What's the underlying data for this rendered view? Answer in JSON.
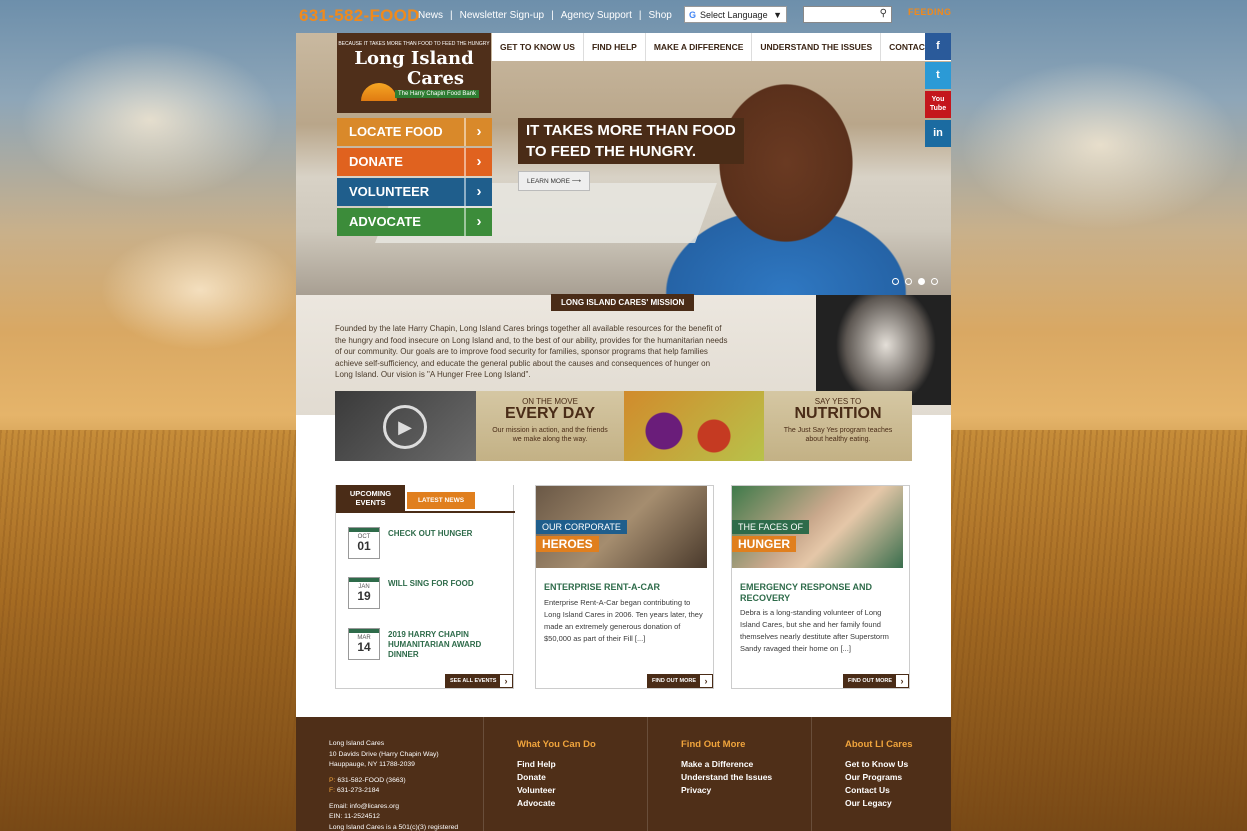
{
  "topbar": {
    "phone": "631-582-FOOD",
    "links": [
      "News",
      "Newsletter Sign-up",
      "Agency Support",
      "Shop"
    ],
    "language_label": "Select Language",
    "feeding_label": "FEEDING"
  },
  "logo": {
    "tagline": "BECAUSE IT TAKES MORE THAN FOOD TO FEED THE HUNGRY",
    "line1": "Long Island",
    "line2": "Cares",
    "subtitle": "The Harry Chapin Food Bank"
  },
  "nav": [
    "GET TO KNOW US",
    "FIND HELP",
    "MAKE A DIFFERENCE",
    "UNDERSTAND THE ISSUES",
    "CONTACT US"
  ],
  "social": [
    "f",
    "t",
    "You Tube",
    "in"
  ],
  "cta": [
    {
      "label": "LOCATE FOOD",
      "color": "#d9892a"
    },
    {
      "label": "DONATE",
      "color": "#e0621f"
    },
    {
      "label": "VOLUNTEER",
      "color": "#1f5e8c"
    },
    {
      "label": "ADVOCATE",
      "color": "#3c8c3a"
    }
  ],
  "hero": {
    "headline1": "IT TAKES MORE THAN FOOD",
    "headline2": "TO FEED THE HUNGRY.",
    "learn_more": "LEARN MORE",
    "slides": 4,
    "active_slide": 3
  },
  "mission": {
    "title": "LONG ISLAND CARES' MISSION",
    "text": "Founded by the late Harry Chapin, Long Island Cares brings together all available resources for the benefit of the hungry and food insecure on Long Island and, to the best of our ability, provides for the humanitarian needs of our community. Our goals are to improve food security for families, sponsor programs that help families achieve self-sufficiency, and educate the general public about the causes and consequences of hunger on Long Island. Our vision is \"A Hunger Free Long Island\"."
  },
  "promo": {
    "everyday": {
      "kicker": "ON THE MOVE",
      "title": "EVERY DAY",
      "desc": "Our mission in action, and the friends we make along the way."
    },
    "nutrition": {
      "kicker": "SAY YES TO",
      "title": "NUTRITION",
      "desc": "The Just Say Yes program teaches about healthy eating."
    }
  },
  "events": {
    "tab_upcoming": "UPCOMING EVENTS",
    "tab_latest": "LATEST NEWS",
    "items": [
      {
        "month": "OCT",
        "day": "01",
        "title": "CHECK OUT HUNGER"
      },
      {
        "month": "JAN",
        "day": "19",
        "title": "WILL SING FOR FOOD"
      },
      {
        "month": "MAR",
        "day": "14",
        "title": "2019 HARRY CHAPIN HUMANITARIAN AWARD DINNER"
      }
    ],
    "see_all": "SEE ALL EVENTS"
  },
  "cards": [
    {
      "label1": "OUR CORPORATE",
      "label2": "HEROES",
      "heading": "ENTERPRISE RENT-A-CAR",
      "body": "Enterprise Rent-A-Car began contributing to Long Island Cares in 2006. Ten years later, they made an extremely generous donation of $50,000 as part of their Fill [...]",
      "more": "FIND OUT MORE"
    },
    {
      "label1": "THE FACES OF",
      "label2": "HUNGER",
      "heading": "EMERGENCY RESPONSE AND RECOVERY",
      "body": "Debra is a long-standing volunteer of Long Island Cares, but she and her family found themselves nearly destitute after Superstorm Sandy ravaged their home on [...]",
      "more": "FIND OUT MORE"
    }
  ],
  "footer": {
    "org": "Long Island Cares",
    "street": "10 Davids Drive (Harry Chapin Way)",
    "city": "Hauppauge, NY 11788-2039",
    "phone_prefix": "P:",
    "phone": "631-582-FOOD (3663)",
    "fax_prefix": "F:",
    "fax": "631-273-2184",
    "email": "Email: info@licares.org",
    "ein": "EIN: 11-2524512",
    "note": "Long Island Cares is a 501(c)(3) registered",
    "columns": [
      {
        "title": "What You Can Do",
        "links": [
          "Find Help",
          "Donate",
          "Volunteer",
          "Advocate"
        ]
      },
      {
        "title": "Find Out More",
        "links": [
          "Make a Difference",
          "Understand the Issues",
          "Privacy"
        ]
      },
      {
        "title": "About LI Cares",
        "links": [
          "Get to Know Us",
          "Our Programs",
          "Contact Us",
          "Our Legacy"
        ]
      }
    ]
  }
}
